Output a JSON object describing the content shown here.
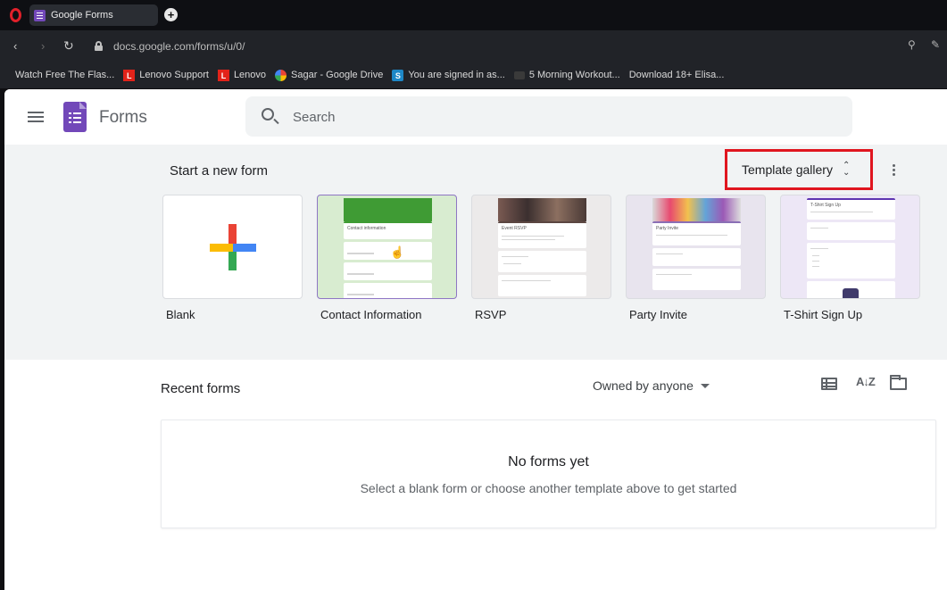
{
  "browser": {
    "tab_title": "Google Forms",
    "url": "docs.google.com/forms/u/0/",
    "bookmarks": [
      {
        "label": "Watch Free The Flas...",
        "icon": "page-icon"
      },
      {
        "label": "Lenovo Support",
        "icon": "lenovo-icon"
      },
      {
        "label": "Lenovo",
        "icon": "lenovo-icon"
      },
      {
        "label": "Sagar - Google Drive",
        "icon": "google-icon"
      },
      {
        "label": "You are signed in as...",
        "icon": "s-icon"
      },
      {
        "label": "5 Morning Workout...",
        "icon": "video-icon"
      },
      {
        "label": "Download 18+ Elisa...",
        "icon": "page-icon"
      }
    ]
  },
  "header": {
    "app_title": "Forms",
    "search_placeholder": "Search"
  },
  "new_form": {
    "title": "Start a new form",
    "template_gallery_label": "Template gallery",
    "templates": [
      {
        "name": "Blank"
      },
      {
        "name": "Contact Information",
        "preview_title": "Contact information"
      },
      {
        "name": "RSVP",
        "preview_title": "Event RSVP"
      },
      {
        "name": "Party Invite",
        "preview_title": "Party Invite"
      },
      {
        "name": "T-Shirt Sign Up",
        "preview_title": "T-Shirt Sign Up"
      }
    ]
  },
  "recent": {
    "title": "Recent forms",
    "owner_filter": "Owned by anyone",
    "empty_title": "No forms yet",
    "empty_subtitle": "Select a blank form or choose another template above to get started"
  },
  "colors": {
    "forms_purple": "#7248b9",
    "highlight_red": "#e0151f",
    "panel_grey": "#f1f3f4"
  }
}
